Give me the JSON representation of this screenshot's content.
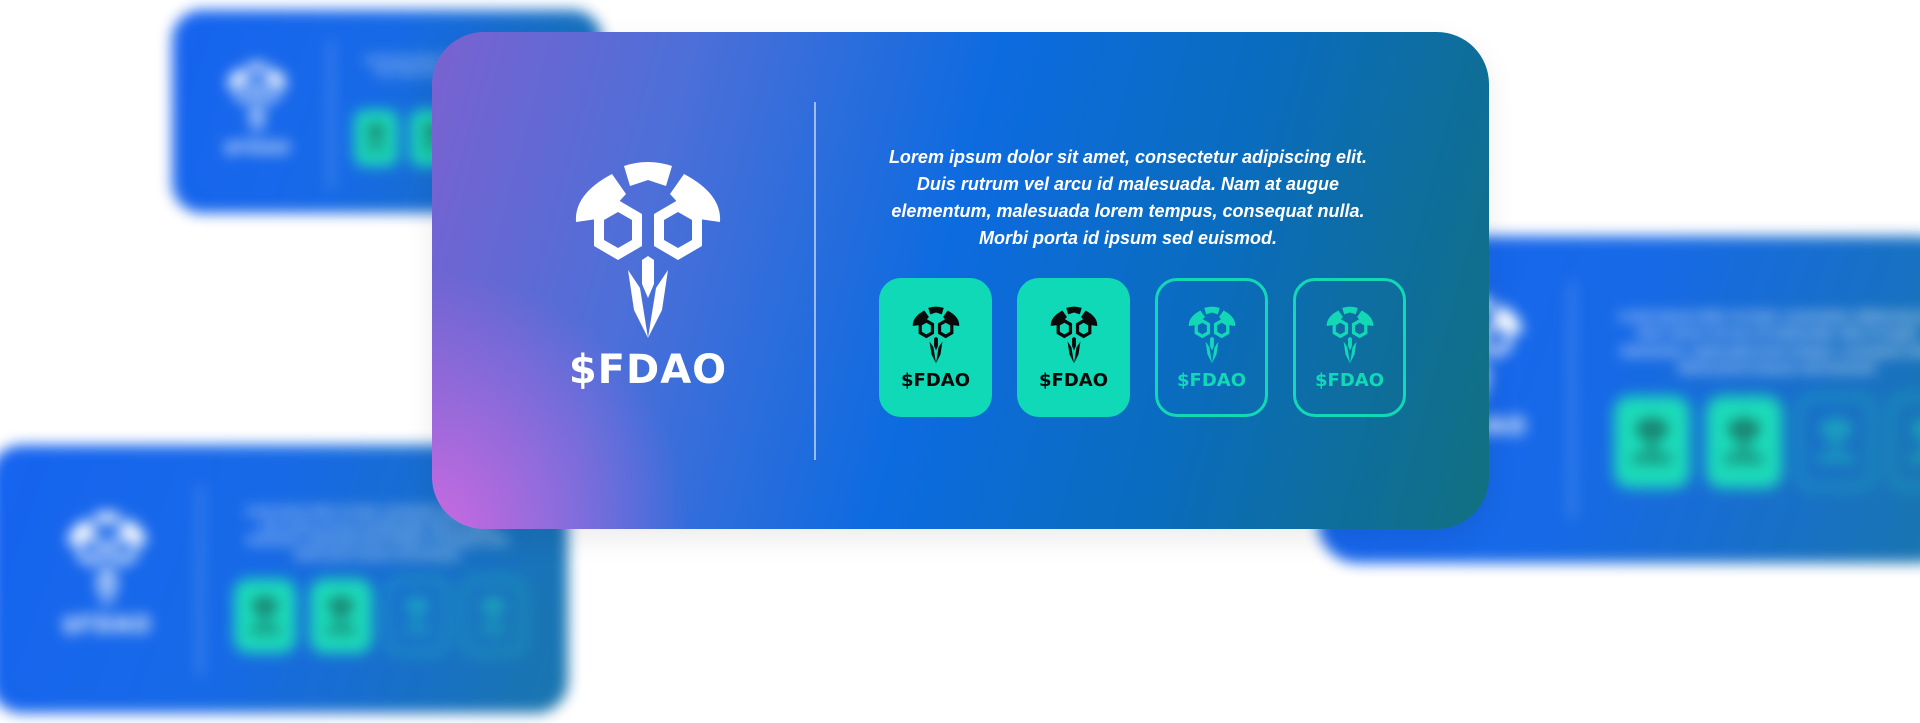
{
  "brand": {
    "name": "$FDAO"
  },
  "description": {
    "lines": [
      "Lorem ipsum dolor sit amet, consectetur adipiscing elit.",
      "Duis rutrum vel arcu id malesuada. Nam at augue",
      "elementum, malesuada lorem tempus, consequat nulla.",
      "Morbi porta id ipsum sed euismod."
    ]
  },
  "tiles": [
    {
      "label": "$FDAO",
      "style": "filled"
    },
    {
      "label": "$FDAO",
      "style": "filled"
    },
    {
      "label": "$FDAO",
      "style": "outline"
    },
    {
      "label": "$FDAO",
      "style": "outline"
    }
  ],
  "colors": {
    "accent_teal": "#0fd9b6",
    "card_blue": "#0a5bf0",
    "gradient_purple": "#7a62d0",
    "gradient_teal": "#127080"
  },
  "icons": {
    "logo": "owl-mask-logo-icon"
  }
}
